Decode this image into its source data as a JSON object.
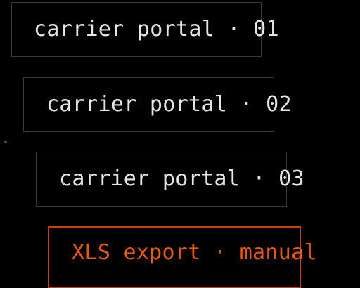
{
  "entries": [
    {
      "label": "carrier portal · 01"
    },
    {
      "label": "carrier portal · 02"
    },
    {
      "label": "carrier portal · 03"
    },
    {
      "label": "XLS export · manual"
    }
  ],
  "colors": {
    "background": "#000000",
    "text": "#e6e6e6",
    "border": "#3a3a3a",
    "accent": "#ea580c",
    "accent_border": "#c2410c"
  }
}
